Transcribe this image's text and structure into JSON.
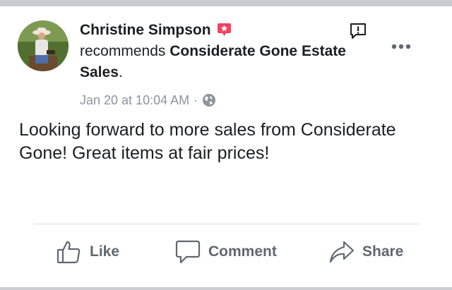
{
  "post": {
    "author": "Christine Simpson",
    "verb": "recommends",
    "page_name": "Considerate Gone Estate Sales",
    "page_suffix": ".",
    "timestamp": "Jan 20 at 10:04 AM",
    "separator": "·",
    "body": "Looking forward to more sales from Considerate Gone!  Great items at fair prices!"
  },
  "actions": {
    "like": "Like",
    "comment": "Comment",
    "share": "Share"
  },
  "icons": {
    "badge": "recommendation-star-badge-icon",
    "privacy": "globe-icon",
    "report": "report-icon",
    "more": "more-options-icon",
    "like": "thumbs-up-icon",
    "comment": "speech-bubble-icon",
    "share": "share-arrow-icon"
  },
  "colors": {
    "badge": "#f3425f",
    "text": "#1c1e21",
    "secondary": "#8d949e",
    "action": "#606770"
  }
}
